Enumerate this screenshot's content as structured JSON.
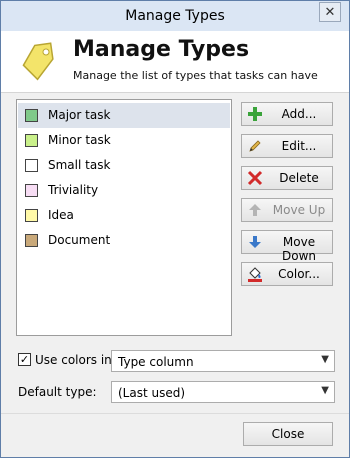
{
  "window": {
    "title": "Manage Types",
    "close_glyph": "✕"
  },
  "header": {
    "title": "Manage Types",
    "subtitle": "Manage the list of types that tasks can have",
    "icon": "tag-icon"
  },
  "types": [
    {
      "label": "Major task",
      "color": "#7fc98a",
      "selected": true
    },
    {
      "label": "Minor task",
      "color": "#c9f08a",
      "selected": false
    },
    {
      "label": "Small task",
      "color": "#ffffff",
      "selected": false
    },
    {
      "label": "Triviality",
      "color": "#f7ddf4",
      "selected": false
    },
    {
      "label": "Idea",
      "color": "#fff9a8",
      "selected": false
    },
    {
      "label": "Document",
      "color": "#c9a97a",
      "selected": false
    }
  ],
  "buttons": {
    "add": {
      "label": "Add...",
      "icon": "plus-icon"
    },
    "edit": {
      "label": "Edit...",
      "icon": "pencil-icon"
    },
    "delete": {
      "label": "Delete",
      "icon": "delete-x-icon"
    },
    "move_up": {
      "label": "Move Up",
      "icon": "arrow-up-icon",
      "disabled": true
    },
    "move_down": {
      "label": "Move Down",
      "icon": "arrow-down-icon"
    },
    "color": {
      "label": "Color...",
      "icon": "paint-bucket-icon"
    }
  },
  "options": {
    "use_colors_label": "Use colors in:",
    "use_colors_checked": true,
    "use_colors_value": "Type column",
    "default_type_label": "Default type:",
    "default_type_value": "(Last used)"
  },
  "footer": {
    "close_label": "Close"
  }
}
